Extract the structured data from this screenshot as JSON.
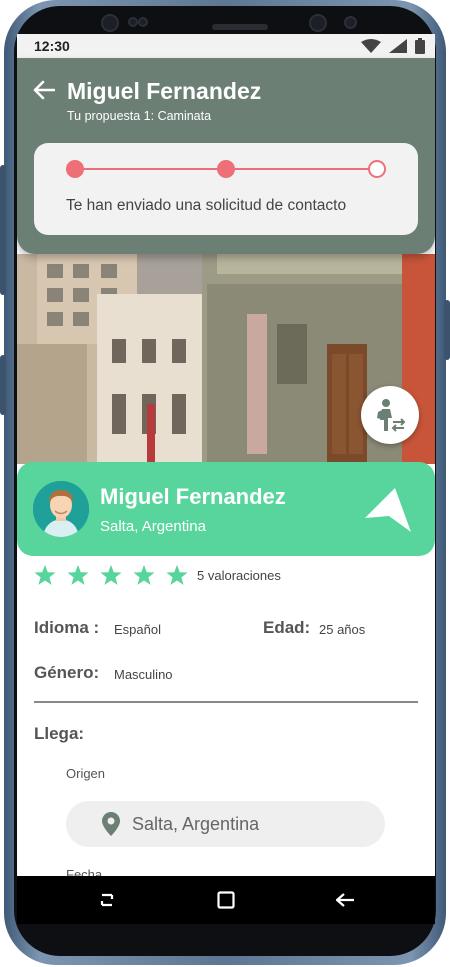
{
  "status_bar": {
    "time": "12:30"
  },
  "header": {
    "title": "Miguel Fernandez",
    "subtitle": "Tu propuesta 1: Caminata",
    "progress_text": "Te han enviado una solicitud de contacto",
    "progress_steps_completed": 2,
    "progress_steps_total": 3
  },
  "profile": {
    "name": "Miguel Fernandez",
    "location": "Salta, Argentina",
    "stars": 5,
    "ratings_text": "5 valoraciones"
  },
  "details": {
    "idioma_label": "Idioma :",
    "idioma_value": "Español",
    "edad_label": "Edad:",
    "edad_value": "25 años",
    "genero_label": "Género:",
    "genero_value": "Masculino",
    "llega_label": "Llega:",
    "origen_label": "Origen",
    "origen_value": "Salta, Argentina",
    "fecha_label": "Fecha"
  },
  "colors": {
    "header_bg": "#6b7f75",
    "accent_green": "#57d59c",
    "progress_red": "#ee6f78",
    "star_color": "#57d59c"
  },
  "icons": {
    "back": "arrow-left-icon",
    "walk": "walking-person-icon",
    "send": "navigation-arrow-icon",
    "pin": "location-pin-icon",
    "nav_recent": "recent-apps-icon",
    "nav_home": "home-square-icon",
    "nav_back": "back-arrow-icon"
  }
}
